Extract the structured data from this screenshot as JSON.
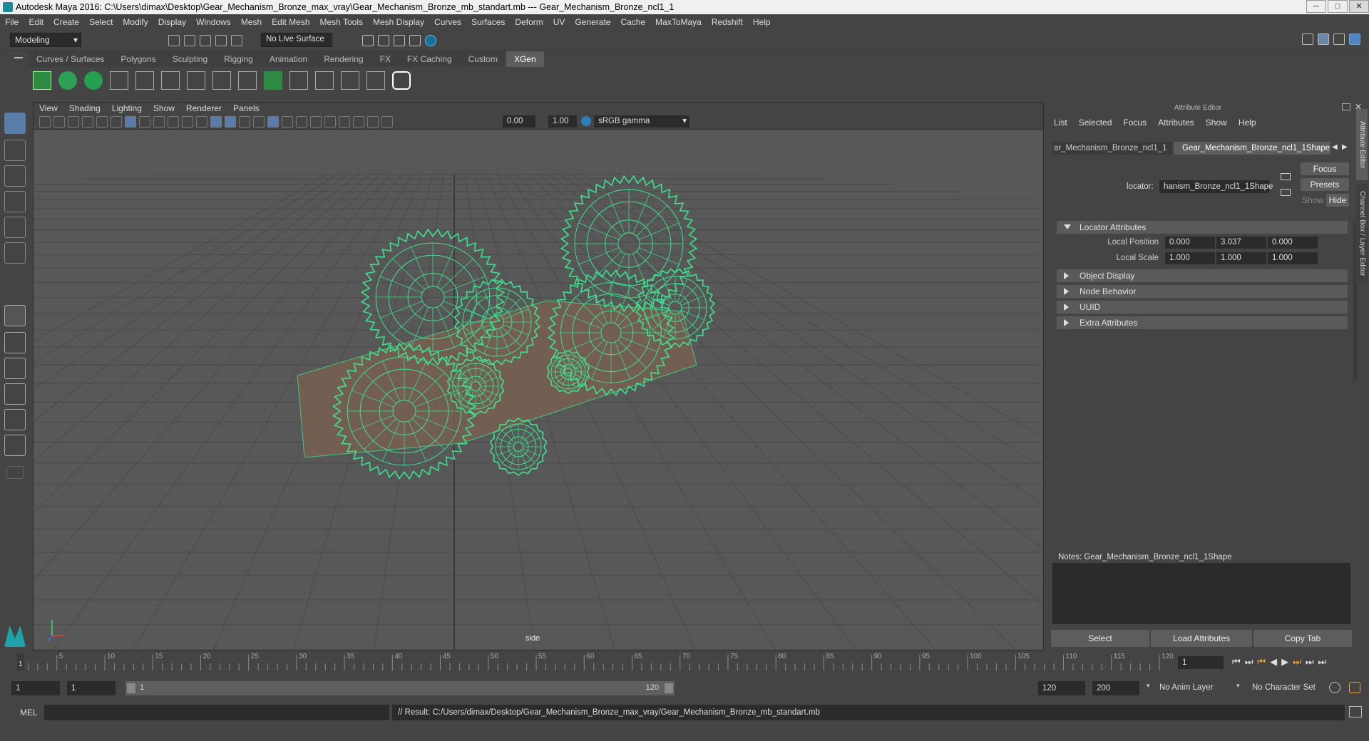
{
  "title": "Autodesk Maya 2016: C:\\Users\\dimax\\Desktop\\Gear_Mechanism_Bronze_max_vray\\Gear_Mechanism_Bronze_mb_standart.mb  ---  Gear_Mechanism_Bronze_ncl1_1",
  "menu": [
    "File",
    "Edit",
    "Create",
    "Select",
    "Modify",
    "Display",
    "Windows",
    "Mesh",
    "Edit Mesh",
    "Mesh Tools",
    "Mesh Display",
    "Curves",
    "Surfaces",
    "Deform",
    "UV",
    "Generate",
    "Cache",
    "MaxToMaya",
    "Redshift",
    "Help"
  ],
  "status": {
    "mode": "Modeling",
    "live_surface": "No Live Surface"
  },
  "shelf_tabs": [
    "Curves / Surfaces",
    "Polygons",
    "Sculpting",
    "Rigging",
    "Animation",
    "Rendering",
    "FX",
    "FX Caching",
    "Custom",
    "XGen"
  ],
  "active_shelf": "XGen",
  "viewport": {
    "menu": [
      "View",
      "Shading",
      "Lighting",
      "Show",
      "Renderer",
      "Panels"
    ],
    "exposure": "0.00",
    "gamma": "1.00",
    "color_space": "sRGB gamma",
    "camera_label": "side"
  },
  "attr_editor": {
    "title": "Attribute Editor",
    "menu": [
      "List",
      "Selected",
      "Focus",
      "Attributes",
      "Show",
      "Help"
    ],
    "tab_left": "ar_Mechanism_Bronze_ncl1_1",
    "tab_right": "Gear_Mechanism_Bronze_ncl1_1Shape",
    "locator_label": "locator:",
    "locator_value": "hanism_Bronze_ncl1_1Shape",
    "focus_btn": "Focus",
    "presets_btn": "Presets",
    "show_btn": "Show",
    "hide_btn": "Hide",
    "sections": [
      "Locator Attributes",
      "Object Display",
      "Node Behavior",
      "UUID",
      "Extra Attributes"
    ],
    "local_position_label": "Local Position",
    "local_position": [
      "0.000",
      "3.037",
      "0.000"
    ],
    "local_scale_label": "Local Scale",
    "local_scale": [
      "1.000",
      "1.000",
      "1.000"
    ],
    "notes_label": "Notes:  Gear_Mechanism_Bronze_ncl1_1Shape",
    "select_btn": "Select",
    "load_btn": "Load Attributes",
    "copy_btn": "Copy Tab",
    "side_tabs": [
      "Attribute Editor",
      "Channel Box / Layer Editor"
    ]
  },
  "timeline": {
    "ticks": [
      "5",
      "10",
      "15",
      "20",
      "25",
      "30",
      "35",
      "40",
      "45",
      "50",
      "55",
      "60",
      "65",
      "70",
      "75",
      "80",
      "85",
      "90",
      "95",
      "100",
      "105",
      "110",
      "115",
      "120"
    ],
    "start_marker": "1",
    "current_frame": "1"
  },
  "range": {
    "start": "1",
    "inner_start": "1",
    "slider_start": "1",
    "slider_end": "120",
    "end": "120",
    "anim_end": "200",
    "anim_layer": "No Anim Layer",
    "char_set": "No Character Set"
  },
  "command": {
    "lang": "MEL",
    "result": "// Result: C:/Users/dimax/Desktop/Gear_Mechanism_Bronze_max_vray/Gear_Mechanism_Bronze_mb_standart.mb"
  },
  "colors": {
    "wire": "#3de28f",
    "bg": "#444444",
    "viewport": "#585858",
    "field": "#2b2b2b"
  }
}
